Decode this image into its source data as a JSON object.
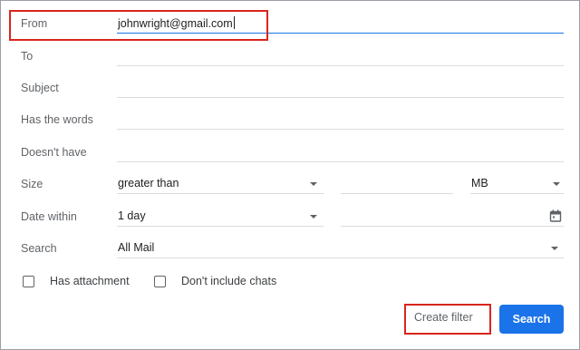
{
  "fields": {
    "from": {
      "label": "From",
      "value": "johnwright@gmail.com"
    },
    "to": {
      "label": "To",
      "value": ""
    },
    "subject": {
      "label": "Subject",
      "value": ""
    },
    "has_words": {
      "label": "Has the words",
      "value": ""
    },
    "doesnt_have": {
      "label": "Doesn't have",
      "value": ""
    },
    "size": {
      "label": "Size",
      "comparator": "greater than",
      "amount": "",
      "unit": "MB"
    },
    "date_within": {
      "label": "Date within",
      "range": "1 day",
      "date": ""
    },
    "search": {
      "label": "Search",
      "scope": "All Mail"
    }
  },
  "checkboxes": {
    "has_attachment": {
      "label": "Has attachment",
      "checked": false
    },
    "no_chats": {
      "label": "Don't include chats",
      "checked": false
    }
  },
  "actions": {
    "create_filter": "Create filter",
    "search": "Search"
  },
  "colors": {
    "accent": "#1a73e8",
    "highlight": "#d9261c",
    "divider": "#dadce0",
    "label": "#5f6368"
  }
}
